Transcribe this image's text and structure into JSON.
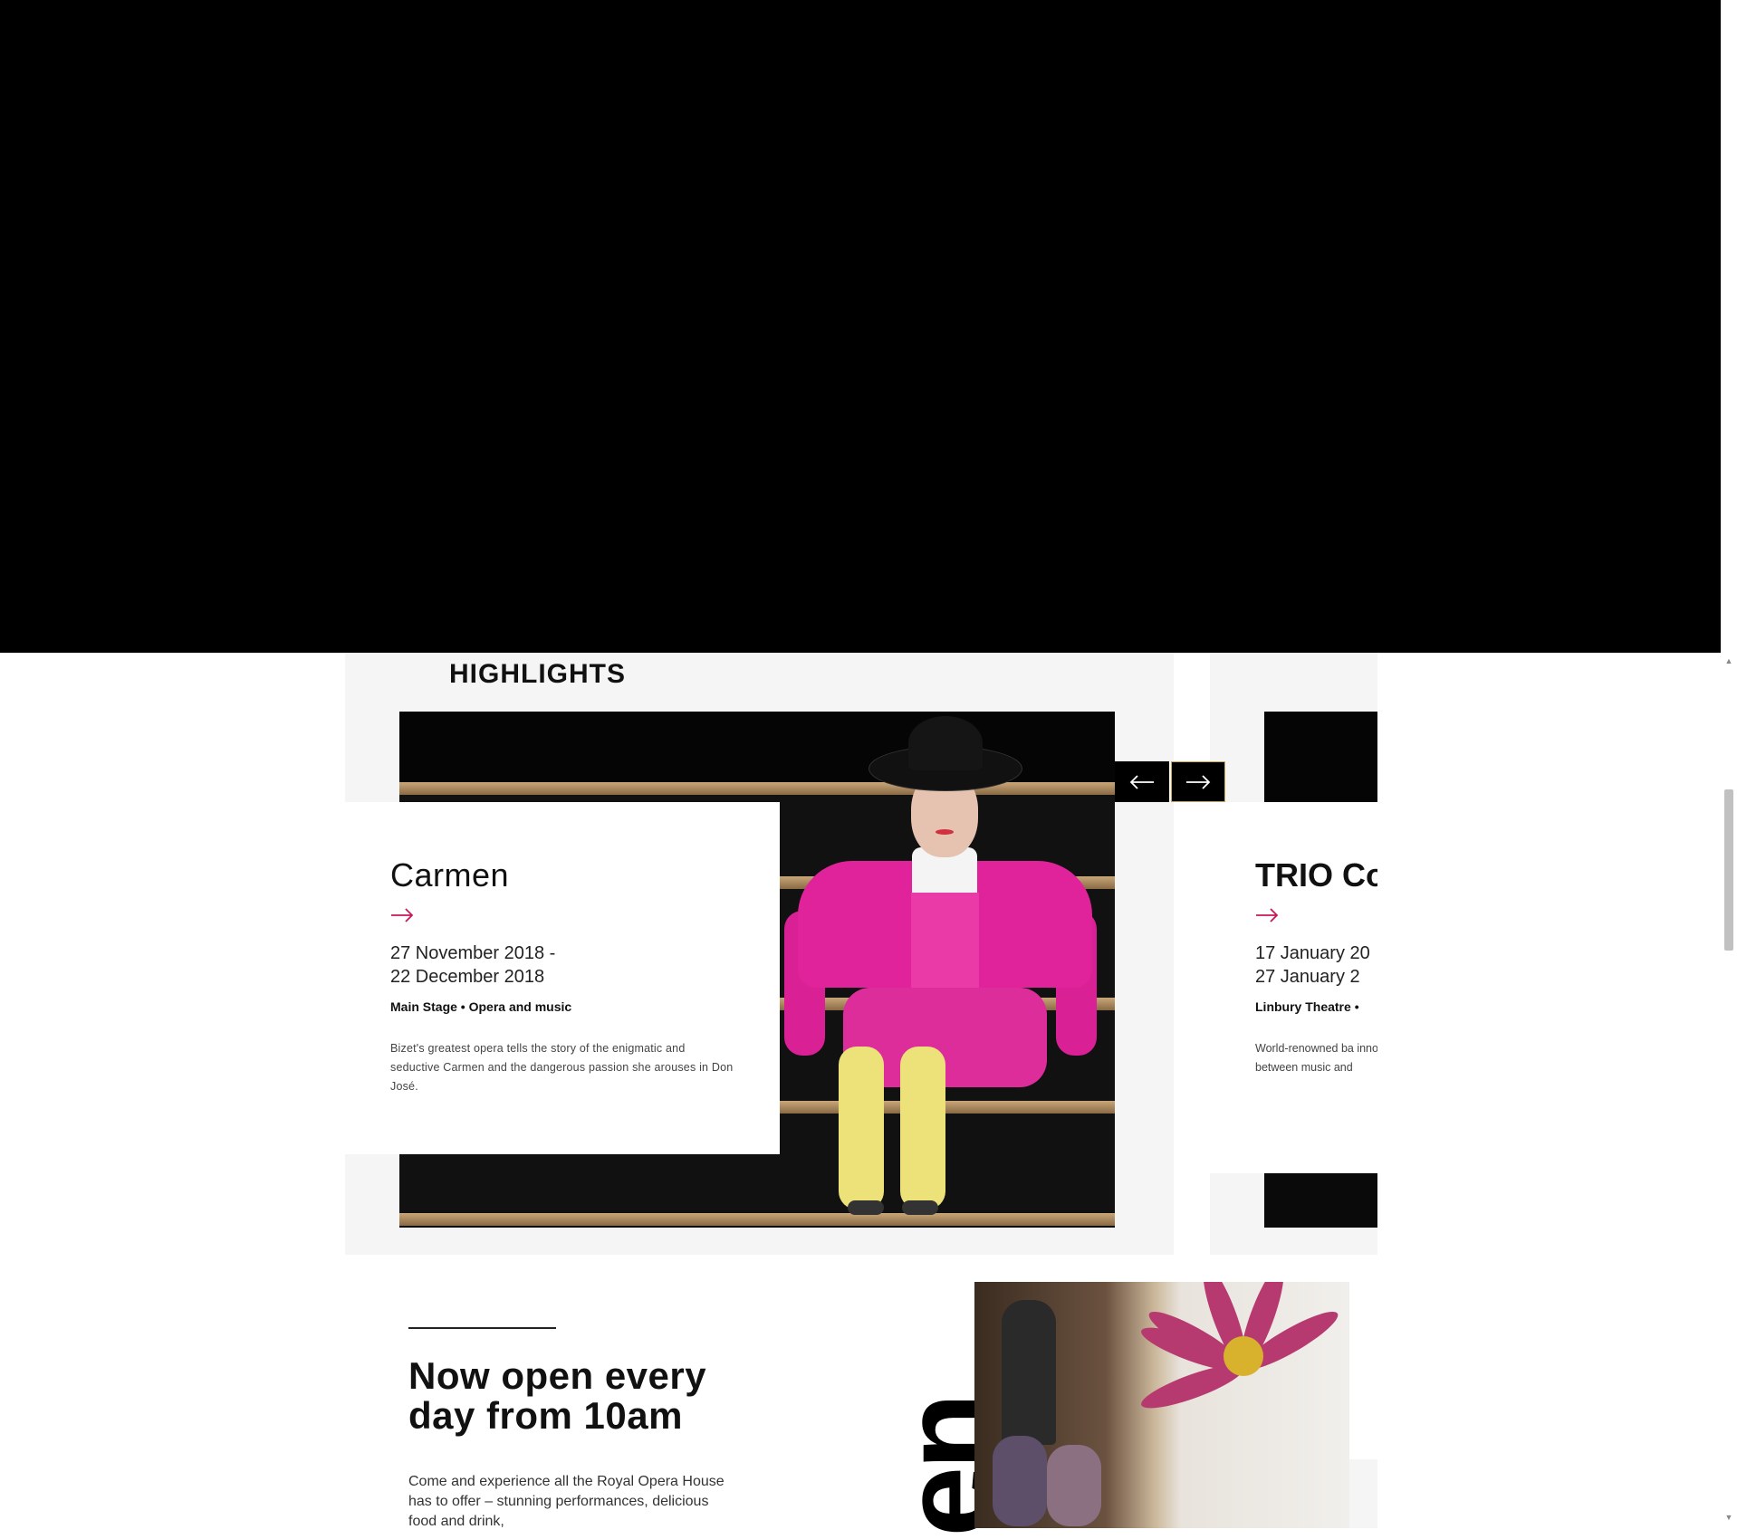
{
  "highlights": {
    "heading": "HIGHLIGHTS",
    "prev_label": "previous",
    "next_label": "next",
    "cards": [
      {
        "title": "Carmen",
        "date_start": "27 November 2018 -",
        "date_end": "22 December 2018",
        "venue": "Main Stage",
        "category": "Opera and music",
        "description": "Bizet's greatest opera tells the story of the enigmatic and seductive Carmen and the dangerous passion she arouses in Don José."
      },
      {
        "title": "TRIO Co",
        "date_start": "17 January 20",
        "date_end": "27 January 2",
        "venue": "Linbury Theatre",
        "category": "",
        "description": "World-renowned ba innovative programi pianist Bruce Leving between music and"
      }
    ]
  },
  "open_section": {
    "title": "Now open every day from 10am",
    "body": "Come and experience all the Royal Opera House has to offer – stunning performances, delicious food and drink,",
    "vertical_word": "en"
  },
  "colors": {
    "accent_arrow": "#c8195a",
    "nav_border": "#c8a85a",
    "panel_bg": "#f5f5f5"
  },
  "icons": {
    "prev": "arrow-left-icon",
    "next": "arrow-right-icon",
    "card_link": "arrow-right-icon"
  }
}
